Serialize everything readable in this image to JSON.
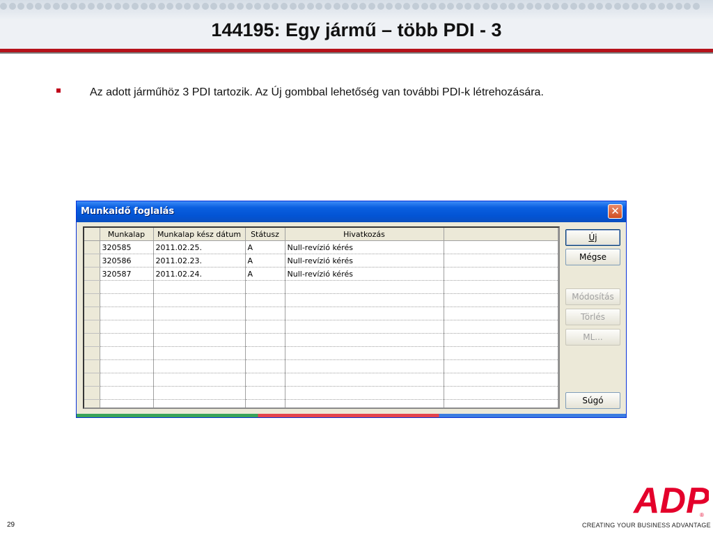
{
  "slide": {
    "title": "144195: Egy jármű – több PDI - 3",
    "bullet": "Az adott járműhöz 3 PDI tartozik. Az Új gombbal lehetőség van további PDI-k létrehozására.",
    "page_number": "29",
    "logo_text": "ADP",
    "tagline": "CREATING YOUR BUSINESS ADVANTAGE"
  },
  "dialog": {
    "title": "Munkaidő foglalás",
    "columns": [
      "Munkalap",
      "Munkalap kész dátum",
      "Státusz",
      "Hivatkozás",
      ""
    ],
    "rows": [
      [
        "320585",
        "2011.02.25.",
        "A",
        "Null-revízió kérés",
        ""
      ],
      [
        "320586",
        "2011.02.23.",
        "A",
        "Null-revízió kérés",
        ""
      ],
      [
        "320587",
        "2011.02.24.",
        "A",
        "Null-revízió kérés",
        ""
      ],
      [
        "",
        "",
        "",
        "",
        ""
      ],
      [
        "",
        "",
        "",
        "",
        ""
      ],
      [
        "",
        "",
        "",
        "",
        ""
      ],
      [
        "",
        "",
        "",
        "",
        ""
      ],
      [
        "",
        "",
        "",
        "",
        ""
      ],
      [
        "",
        "",
        "",
        "",
        ""
      ],
      [
        "",
        "",
        "",
        "",
        ""
      ],
      [
        "",
        "",
        "",
        "",
        ""
      ],
      [
        "",
        "",
        "",
        "",
        ""
      ],
      [
        "",
        "",
        "",
        "",
        ""
      ]
    ],
    "buttons": {
      "new": "Új",
      "cancel": "Mégse",
      "modify": "Módosítás",
      "delete": "Törlés",
      "ml": "ML...",
      "help": "Súgó"
    }
  }
}
